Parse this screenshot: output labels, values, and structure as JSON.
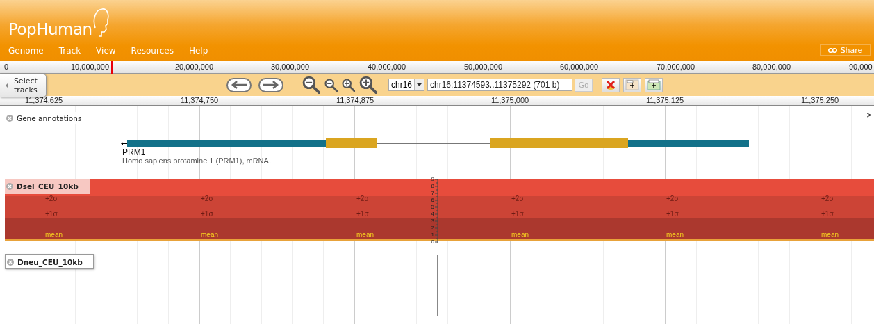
{
  "header": {
    "logo": "PopHuman",
    "menu": [
      "Genome",
      "Track",
      "View",
      "Resources",
      "Help"
    ],
    "share_button": "Share"
  },
  "overview_ruler": {
    "labels": [
      "0",
      "10,000,000",
      "20,000,000",
      "30,000,000",
      "40,000,000",
      "50,000,000",
      "60,000,000",
      "70,000,000",
      "80,000,000",
      "90,000"
    ]
  },
  "navigation": {
    "select_tracks": "Select tracks",
    "chromosome": "chr16",
    "location": "chr16:11374593..11375292 (701 b)",
    "go_button": {
      "label": "Go",
      "disabled": true
    }
  },
  "detail_ruler": {
    "labels": [
      "11,374,625",
      "11,374,750",
      "11,374,875",
      "11,375,000",
      "11,375,125",
      "11,375,250"
    ]
  },
  "tracks": [
    {
      "kind": "gene",
      "label": "Gene annotations",
      "feature": {
        "name": "PRM1",
        "description": "Homo sapiens protamine 1 (PRM1), mRNA."
      }
    },
    {
      "kind": "score",
      "label": "Dsel_CEU_10kb",
      "columns": [
        {
          "upper": "+2σ",
          "middle": "+1σ",
          "lower": "mean"
        },
        {
          "upper": "+2σ",
          "middle": "+1σ",
          "lower": "mean"
        },
        {
          "upper": "+2σ",
          "middle": "+1σ",
          "lower": "mean"
        },
        {
          "upper": "+2σ",
          "middle": "+1σ",
          "lower": "mean"
        },
        {
          "upper": "+2σ",
          "middle": "+1σ",
          "lower": "mean"
        },
        {
          "upper": "+2σ",
          "middle": "+1σ",
          "lower": "mean"
        }
      ],
      "y_ticks": [
        "9",
        "8",
        "7",
        "6",
        "5",
        "4",
        "3",
        "2",
        "1",
        "0"
      ]
    },
    {
      "kind": "plain",
      "label": "Dneu_CEU_10kb"
    }
  ]
}
